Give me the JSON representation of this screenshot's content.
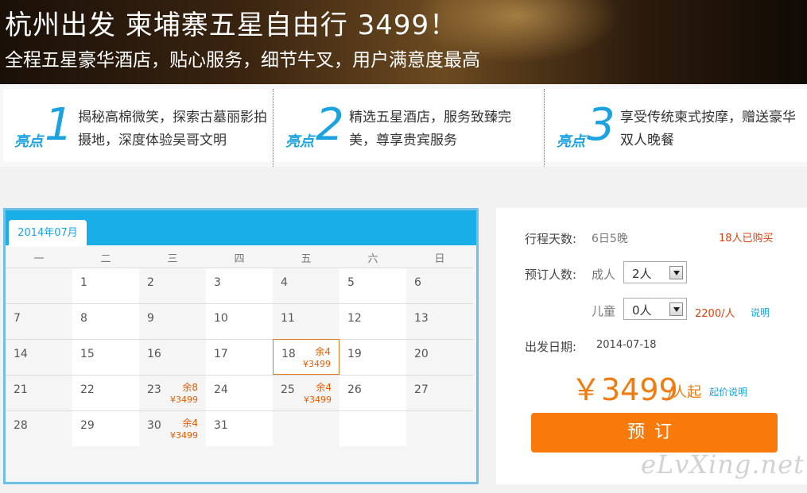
{
  "banner": {
    "title": "杭州出发 柬埔寨五星自由行 3499！",
    "subtitle": "全程五星豪华酒店，贴心服务，细节牛叉，用户满意度最高"
  },
  "highlights": [
    {
      "tag": "亮点",
      "num": "1",
      "text": "揭秘高棉微笑，探索古墓丽影拍摄地，深度体验吴哥文明"
    },
    {
      "tag": "亮点",
      "num": "2",
      "text": "精选五星酒店，服务致臻完美，尊享贵宾服务"
    },
    {
      "tag": "亮点",
      "num": "3",
      "text": "享受传统柬式按摩，赠送豪华双人晚餐"
    }
  ],
  "calendar": {
    "month": "2014年07月",
    "weekdays": [
      "一",
      "二",
      "三",
      "四",
      "五",
      "六",
      "日"
    ],
    "rows": [
      [
        "",
        "1",
        "2",
        "3",
        "4",
        "5",
        "6"
      ],
      [
        "7",
        "8",
        "9",
        "10",
        "11",
        "12",
        "13"
      ],
      [
        "14",
        "15",
        "16",
        "17",
        "18",
        "19",
        "20"
      ],
      [
        "21",
        "22",
        "23",
        "24",
        "25",
        "26",
        "27"
      ],
      [
        "28",
        "29",
        "30",
        "31",
        "",
        "",
        ""
      ]
    ],
    "available": [
      {
        "day": "18",
        "remaining": "余4",
        "price": "¥3499"
      },
      {
        "day": "23",
        "remaining": "余8",
        "price": "¥3499"
      },
      {
        "day": "25",
        "remaining": "余4",
        "price": "¥3499"
      },
      {
        "day": "30",
        "remaining": "余4",
        "price": "¥3499"
      }
    ],
    "selected_day": "18"
  },
  "booking": {
    "days_label": "行程天数:",
    "days_value": "6日5晚",
    "sold": "18人已购买",
    "people_label": "预订人数:",
    "adult_label": "成人",
    "adult_value": "2人",
    "child_label": "儿童",
    "child_value": "0人",
    "child_price": "2200/人",
    "explain": "说明",
    "date_label": "出发日期:",
    "date_value": "2014-07-18",
    "price": "￥3499",
    "price_unit": "/人起",
    "price_explain": "起价说明",
    "book_label": "预订"
  },
  "watermark": "eLvXing.net",
  "colors": {
    "accent": "#1aa3e0",
    "orange": "#f77a0a",
    "red": "#e04010"
  }
}
